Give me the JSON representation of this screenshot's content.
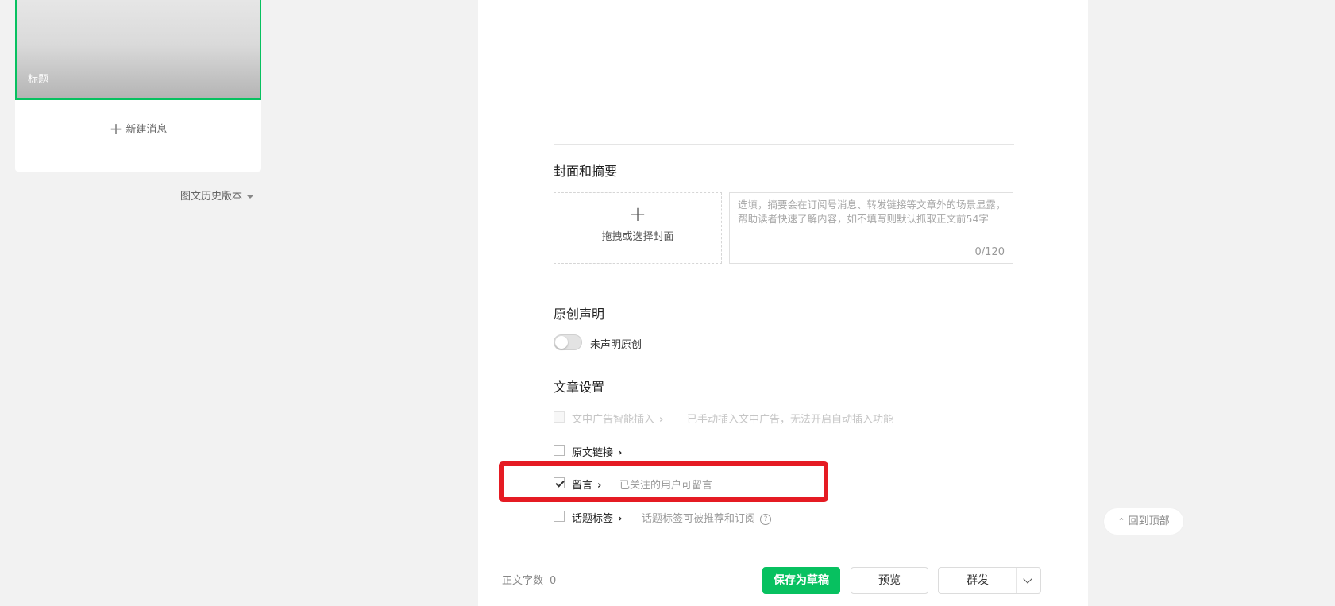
{
  "sidebar": {
    "cover_title": "标题",
    "new_message": "新建消息",
    "history_version": "图文历史版本",
    "accent_color": "#07c160"
  },
  "cover_summary": {
    "section_title": "封面和摘要",
    "upload_plus": "+",
    "upload_label": "拖拽或选择封面",
    "summary_placeholder": "选填，摘要会在订阅号消息、转发链接等文章外的场景显露，帮助读者快速了解内容，如不填写则默认抓取正文前54字",
    "summary_count": "0/120"
  },
  "original": {
    "section_title": "原创声明",
    "toggle_label": "未声明原创",
    "toggle_on": false
  },
  "article_settings": {
    "section_title": "文章设置",
    "options": [
      {
        "label": "文中广告智能插入",
        "chevron": "›",
        "desc": "已手动插入文中广告，无法开启自动插入功能",
        "checked": false,
        "disabled": true
      },
      {
        "label": "原文链接",
        "chevron": "›",
        "desc": "",
        "checked": false,
        "disabled": false
      },
      {
        "label": "留言",
        "chevron": "›",
        "desc": "已关注的用户可留言",
        "checked": true,
        "disabled": false
      },
      {
        "label": "话题标签",
        "chevron": "›",
        "desc": "话题标签可被推荐和订阅",
        "checked": false,
        "disabled": false,
        "help": "?"
      }
    ]
  },
  "footer": {
    "word_count_label": "正文字数",
    "word_count_value": "0",
    "save_draft": "保存为草稿",
    "preview": "预览",
    "send": "群发"
  },
  "back_to_top": "回到顶部",
  "back_to_top_icon": "⌃",
  "highlight_color": "#e51b23"
}
